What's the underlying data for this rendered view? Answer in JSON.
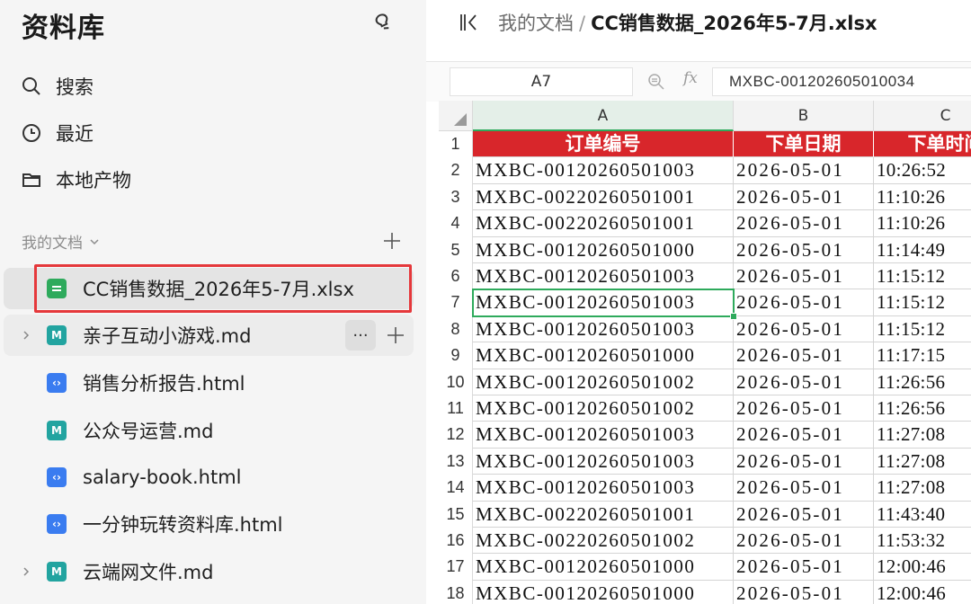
{
  "sidebar": {
    "title": "资料库",
    "nav": [
      {
        "label": "搜索",
        "icon": "search-icon"
      },
      {
        "label": "最近",
        "icon": "clock-icon"
      },
      {
        "label": "本地产物",
        "icon": "folder-icon"
      }
    ],
    "section_label": "我的文档",
    "files": [
      {
        "name": "CC销售数据_2026年5-7月.xlsx",
        "type": "xlsx"
      },
      {
        "name": "亲子互动小游戏.md",
        "type": "md"
      },
      {
        "name": "销售分析报告.html",
        "type": "html"
      },
      {
        "name": "公众号运营.md",
        "type": "md"
      },
      {
        "name": "salary-book.html",
        "type": "html"
      },
      {
        "name": "一分钟玩转资料库.html",
        "type": "html"
      },
      {
        "name": "云端网文件.md",
        "type": "md"
      }
    ],
    "more_label": "···"
  },
  "breadcrumb": {
    "parent": "我的文档",
    "separator": "/",
    "current": "CC销售数据_2026年5-7月.xlsx"
  },
  "formula_bar": {
    "cell_ref": "A7",
    "fx": "fx",
    "value": "MXBC-001202605010034"
  },
  "sheet": {
    "columns": [
      "A",
      "B",
      "C"
    ],
    "header_row": [
      "订单编号",
      "下单日期",
      "下单时间"
    ],
    "rows": [
      [
        "MXBC-00120260501003",
        "2026-05-01",
        "10:26:52"
      ],
      [
        "MXBC-00220260501001",
        "2026-05-01",
        "11:10:26"
      ],
      [
        "MXBC-00220260501001",
        "2026-05-01",
        "11:10:26"
      ],
      [
        "MXBC-00120260501000",
        "2026-05-01",
        "11:14:49"
      ],
      [
        "MXBC-00120260501003",
        "2026-05-01",
        "11:15:12"
      ],
      [
        "MXBC-00120260501003",
        "2026-05-01",
        "11:15:12"
      ],
      [
        "MXBC-00120260501003",
        "2026-05-01",
        "11:15:12"
      ],
      [
        "MXBC-00120260501000",
        "2026-05-01",
        "11:17:15"
      ],
      [
        "MXBC-00120260501002",
        "2026-05-01",
        "11:26:56"
      ],
      [
        "MXBC-00120260501002",
        "2026-05-01",
        "11:26:56"
      ],
      [
        "MXBC-00120260501003",
        "2026-05-01",
        "11:27:08"
      ],
      [
        "MXBC-00120260501003",
        "2026-05-01",
        "11:27:08"
      ],
      [
        "MXBC-00120260501003",
        "2026-05-01",
        "11:27:08"
      ],
      [
        "MXBC-00220260501001",
        "2026-05-01",
        "11:43:40"
      ],
      [
        "MXBC-00220260501002",
        "2026-05-01",
        "11:53:32"
      ],
      [
        "MXBC-00120260501000",
        "2026-05-01",
        "12:00:46"
      ],
      [
        "MXBC-00120260501000",
        "2026-05-01",
        "12:00:46"
      ]
    ],
    "active_row": 7,
    "colors": {
      "header_bg": "#d8262b",
      "selection": "#2eaa5c"
    }
  }
}
